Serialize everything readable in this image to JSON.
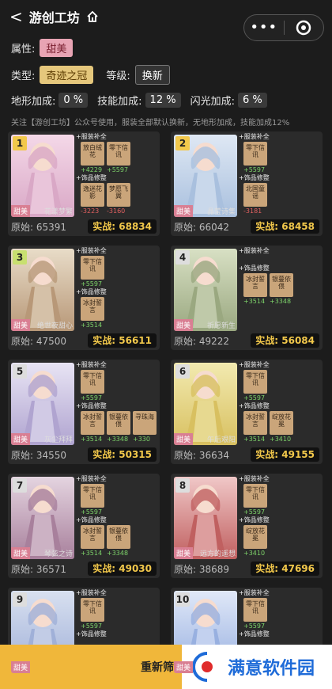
{
  "header": {
    "back": "<",
    "title": "游创工坊",
    "home_icon": "home-icon",
    "more_icon": "•••",
    "target_icon": "target-icon"
  },
  "filters": {
    "attribute_label": "属性:",
    "attribute_value": "甜美",
    "type_label": "类型:",
    "type_value": "奇迹之冠",
    "level_label": "等级:",
    "level_value": "换新",
    "terrain_label": "地形加成:",
    "terrain_value": "0 %",
    "skill_label": "技能加成:",
    "skill_value": "12 %",
    "flash_label": "闪光加成:",
    "flash_value": "6 %"
  },
  "note": "关注【游创工坊】公众号使用，服装全部默认换新，无地形加成，技能加成12%",
  "labels": {
    "costume": "+服装补全",
    "accessory": "+饰品修整",
    "orig": "原始:",
    "real": "实战:"
  },
  "colors": {
    "gold": "#f2c84b",
    "pink": "#e8a4b4",
    "positive": "#7dd36a",
    "negative": "#e06060"
  },
  "cards": [
    {
      "rank": "1",
      "attr": "甜美",
      "suit": "花漾梦繁",
      "orig": "65391",
      "real": "68834",
      "costume_items": [
        {
          "name": "放白绒花",
          "val": "+4229"
        },
        {
          "name": "零下信讯",
          "val": "+5597"
        }
      ],
      "accessory_items": [
        {
          "name": "逸迷花影",
          "val": "-3223"
        },
        {
          "name": "梦愿飞翼",
          "val": "-3160"
        }
      ]
    },
    {
      "rank": "2",
      "attr": "甜美",
      "suit": "晶莹诗集",
      "orig": "66042",
      "real": "68458",
      "costume_items": [
        {
          "name": "零下信讯",
          "val": "+5597"
        }
      ],
      "accessory_items": [
        {
          "name": "北国童谣",
          "val": "-3181"
        }
      ]
    },
    {
      "rank": "3",
      "attr": "甜美",
      "suit": "绝世夜甜心",
      "orig": "47500",
      "real": "56611",
      "costume_items": [
        {
          "name": "零下信讯",
          "val": "+5597"
        }
      ],
      "accessory_items": [
        {
          "name": "冰封誓言",
          "val": "+3514"
        }
      ]
    },
    {
      "rank": "4",
      "attr": "甜美",
      "suit": "祈愿新生",
      "orig": "49222",
      "real": "56084",
      "costume_items": [],
      "accessory_items": [
        {
          "name": "冰封誓言",
          "val": "+3514"
        },
        {
          "name": "银蔓依偎",
          "val": "+3348"
        }
      ]
    },
    {
      "rank": "5",
      "attr": "甜美",
      "suit": "灰尘拜拜",
      "orig": "34550",
      "real": "50315",
      "costume_items": [
        {
          "name": "零下信讯",
          "val": "+5597"
        }
      ],
      "accessory_items": [
        {
          "name": "冰封誓言",
          "val": "+3514"
        },
        {
          "name": "银蔓依偎",
          "val": "+3348"
        },
        {
          "name": "寻珠海",
          "val": "+330"
        }
      ]
    },
    {
      "rank": "6",
      "attr": "甜美",
      "suit": "午后艰阳",
      "orig": "36634",
      "real": "49155",
      "costume_items": [
        {
          "name": "零下信讯",
          "val": "+5597"
        }
      ],
      "accessory_items": [
        {
          "name": "冰封誓言",
          "val": "+3514"
        },
        {
          "name": "绽放花冕",
          "val": "+3410"
        }
      ]
    },
    {
      "rank": "7",
      "attr": "甜美",
      "suit": "琴弦之诗",
      "orig": "36571",
      "real": "49030",
      "costume_items": [
        {
          "name": "零下信讯",
          "val": "+5597"
        }
      ],
      "accessory_items": [
        {
          "name": "冰封誓言",
          "val": "+3514"
        },
        {
          "name": "银蔓依偎",
          "val": "+3348"
        }
      ]
    },
    {
      "rank": "8",
      "attr": "甜美",
      "suit": "远方的遥想",
      "orig": "38689",
      "real": "47696",
      "costume_items": [
        {
          "name": "零下信讯",
          "val": "+5597"
        }
      ],
      "accessory_items": [
        {
          "name": "绽放花冕",
          "val": "+3410"
        }
      ]
    },
    {
      "rank": "9",
      "attr": "甜美",
      "suit": "",
      "orig": "",
      "real": "",
      "costume_items": [
        {
          "name": "零下信讯",
          "val": "+5597"
        }
      ],
      "accessory_items": []
    },
    {
      "rank": "10",
      "attr": "甜美",
      "suit": "",
      "orig": "",
      "real": "",
      "costume_items": [
        {
          "name": "零下信讯",
          "val": "+5597"
        }
      ],
      "accessory_items": []
    }
  ],
  "footer": {
    "button": "重新筛",
    "watermark": "满意软件园"
  }
}
